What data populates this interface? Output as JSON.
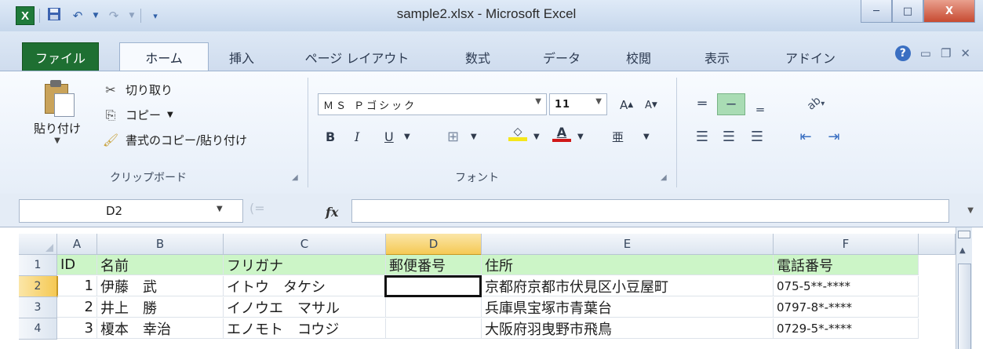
{
  "window": {
    "title": "sample2.xlsx - Microsoft Excel",
    "app_icon": "X",
    "qat": {
      "save_icon": "save-icon",
      "undo_icon": "undo-icon",
      "redo_icon": "redo-icon",
      "customize_icon": "customize-qat-icon"
    },
    "buttons": {
      "minimize": "─",
      "maximize": "□",
      "close": "X"
    }
  },
  "tabs": [
    "ファイル",
    "ホーム",
    "挿入",
    "ページ レイアウト",
    "数式",
    "データ",
    "校閲",
    "表示",
    "アドイン"
  ],
  "ribbon": {
    "clipboard": {
      "paste": "貼り付け",
      "cut": "切り取り",
      "copy": "コピー",
      "format_painter": "書式のコピー/貼り付け",
      "group_label": "クリップボード"
    },
    "font": {
      "font_name": "ＭＳ Ｐゴシック",
      "font_size": "11",
      "bold": "B",
      "italic": "I",
      "underline": "U",
      "grow": "A",
      "shrink": "A",
      "font_color": "A",
      "phonetic": "亜",
      "group_label": "フォント"
    },
    "alignment": {
      "orientation": "ab"
    }
  },
  "formula_bar": {
    "name_box": "D2",
    "fx_label": "fx",
    "formula": ""
  },
  "columns": [
    "A",
    "B",
    "C",
    "D",
    "E",
    "F"
  ],
  "selected_column": "D",
  "rows": [
    {
      "num": "1",
      "cells": [
        "ID",
        "名前",
        "フリガナ",
        "郵便番号",
        "住所",
        "電話番号"
      ]
    },
    {
      "num": "2",
      "cells": [
        "1",
        "伊藤　武",
        "イトウ　タケシ",
        "",
        "京都府京都市伏見区小豆屋町",
        "075-5**-****"
      ]
    },
    {
      "num": "3",
      "cells": [
        "2",
        "井上　勝",
        "イノウエ　マサル",
        "",
        "兵庫県宝塚市青葉台",
        "0797-8*-****"
      ]
    },
    {
      "num": "4",
      "cells": [
        "3",
        "榎本　幸治",
        "エノモト　コウジ",
        "",
        "大阪府羽曳野市飛鳥",
        "0729-5*-****"
      ]
    }
  ],
  "active_cell": "D2",
  "colors": {
    "file_tab": "#1e6f32",
    "header_fill": "#ccf5c7",
    "selected_header": "#f5c954"
  }
}
